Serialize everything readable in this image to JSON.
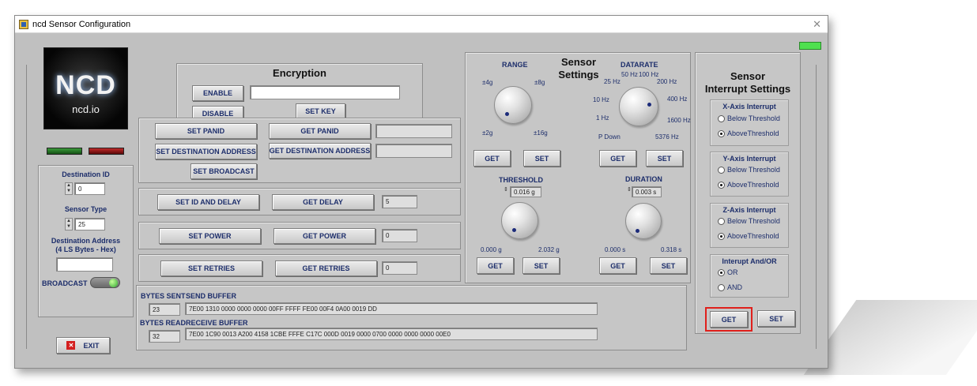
{
  "window": {
    "title": "ncd Sensor Configuration",
    "close_glyph": "✕"
  },
  "logo": {
    "big": "NCD",
    "sub": "ncd.io"
  },
  "encryption": {
    "title": "Encryption",
    "enable": "ENABLE",
    "disable": "DISABLE",
    "set_key": "SET KEY",
    "key_value": ""
  },
  "network": {
    "set_panid": "SET PANID",
    "get_panid": "GET PANID",
    "panid_value": "",
    "set_dest": "SET DESTINATION ADDRESS",
    "get_dest": "GET DESTINATION ADDRESS",
    "dest_value": "",
    "set_broadcast": "SET BROADCAST"
  },
  "delay": {
    "set": "SET ID AND DELAY",
    "get": "GET DELAY",
    "value": "5"
  },
  "power": {
    "set": "SET POWER",
    "get": "GET POWER",
    "value": "0"
  },
  "retries": {
    "set": "SET RETRIES",
    "get": "GET RETRIES",
    "value": "0"
  },
  "buffers": {
    "bytes_sent_label": "BYTES SENT",
    "bytes_sent": "23",
    "send_label": "SEND BUFFER",
    "send": "7E00 1310 0000 0000 0000 00FF FFFF FE00 00F4 0A00 0019 DD",
    "bytes_read_label": "BYTES READ",
    "bytes_read": "32",
    "receive_label": "RECEIVE BUFFER",
    "receive": "7E00 1C90 0013 A200 4158 1CBE FFFE C17C 000D 0019 0000 0700 0000 0000 0000 00E0"
  },
  "left": {
    "dest_id_label": "Destination ID",
    "dest_id": "0",
    "sensor_type_label": "Sensor Type",
    "sensor_type": "25",
    "dest_addr_label1": "Destination Address",
    "dest_addr_label2": "(4 LS Bytes - Hex)",
    "dest_addr": "",
    "broadcast_label": "BROADCAST",
    "exit": "EXIT"
  },
  "sensor_settings": {
    "title_line1": "Sensor",
    "title_line2": "Settings",
    "range": {
      "label": "RANGE",
      "ticks": [
        "±4g",
        "±8g",
        "±2g",
        "±16g"
      ],
      "get": "GET",
      "set": "SET"
    },
    "datarate": {
      "label": "DATARATE",
      "ticks": [
        "25 Hz",
        "50 Hz",
        "100 Hz",
        "200 Hz",
        "10 Hz",
        "400 Hz",
        "1 Hz",
        "1600 Hz",
        "P Down",
        "5376 Hz"
      ],
      "get": "GET",
      "set": "SET"
    },
    "threshold": {
      "label": "THRESHOLD",
      "value": "0.016 g",
      "min": "0.000 g",
      "max": "2.032 g",
      "get": "GET",
      "set": "SET"
    },
    "duration": {
      "label": "DURATION",
      "value": "0.003 s",
      "min": "0.000 s",
      "max": "0.318 s",
      "get": "GET",
      "set": "SET"
    }
  },
  "interrupt": {
    "title_line1": "Sensor",
    "title_line2": "Interrupt Settings",
    "x": {
      "label": "X-Axis Interrupt",
      "below": "Below Threshold",
      "above": "AboveThreshold"
    },
    "y": {
      "label": "Y-Axis Interrupt",
      "below": "Below Threshold",
      "above": "AboveThreshold"
    },
    "z": {
      "label": "Z-Axis Interrupt",
      "below": "Below Threshold",
      "above": "AboveThreshold"
    },
    "andor": {
      "label": "Interupt And/OR",
      "or": "OR",
      "and": "AND"
    },
    "get": "GET",
    "set": "SET"
  },
  "colors": {
    "highlight": "#e0201c",
    "led_green": "#2a8a2a",
    "led_red": "#a01818",
    "status_green": "#4fe04f"
  }
}
